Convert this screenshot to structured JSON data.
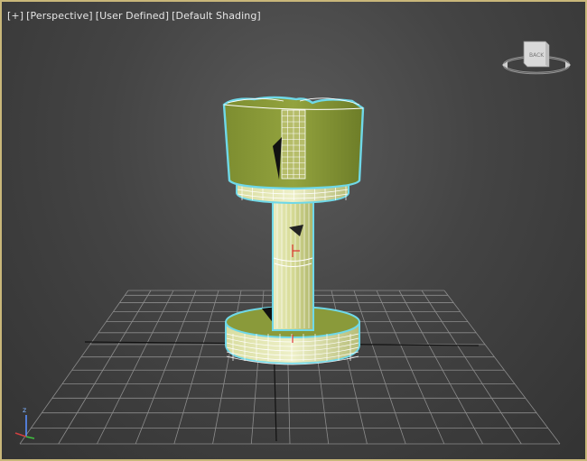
{
  "viewport": {
    "labels": {
      "plus": "[+]",
      "view": "[Perspective]",
      "mode": "[User Defined]",
      "shading": "[Default Shading]"
    }
  },
  "viewcube": {
    "face_label": "BACK"
  },
  "axis_tripod": {
    "z_label": "z"
  },
  "colors": {
    "viewport_border": "#c9b77a",
    "object_fill": "#8a9a3a",
    "selection_outline": "#6fd8e8",
    "wireframe": "#ffffff",
    "grid": "#8c8c8c"
  }
}
